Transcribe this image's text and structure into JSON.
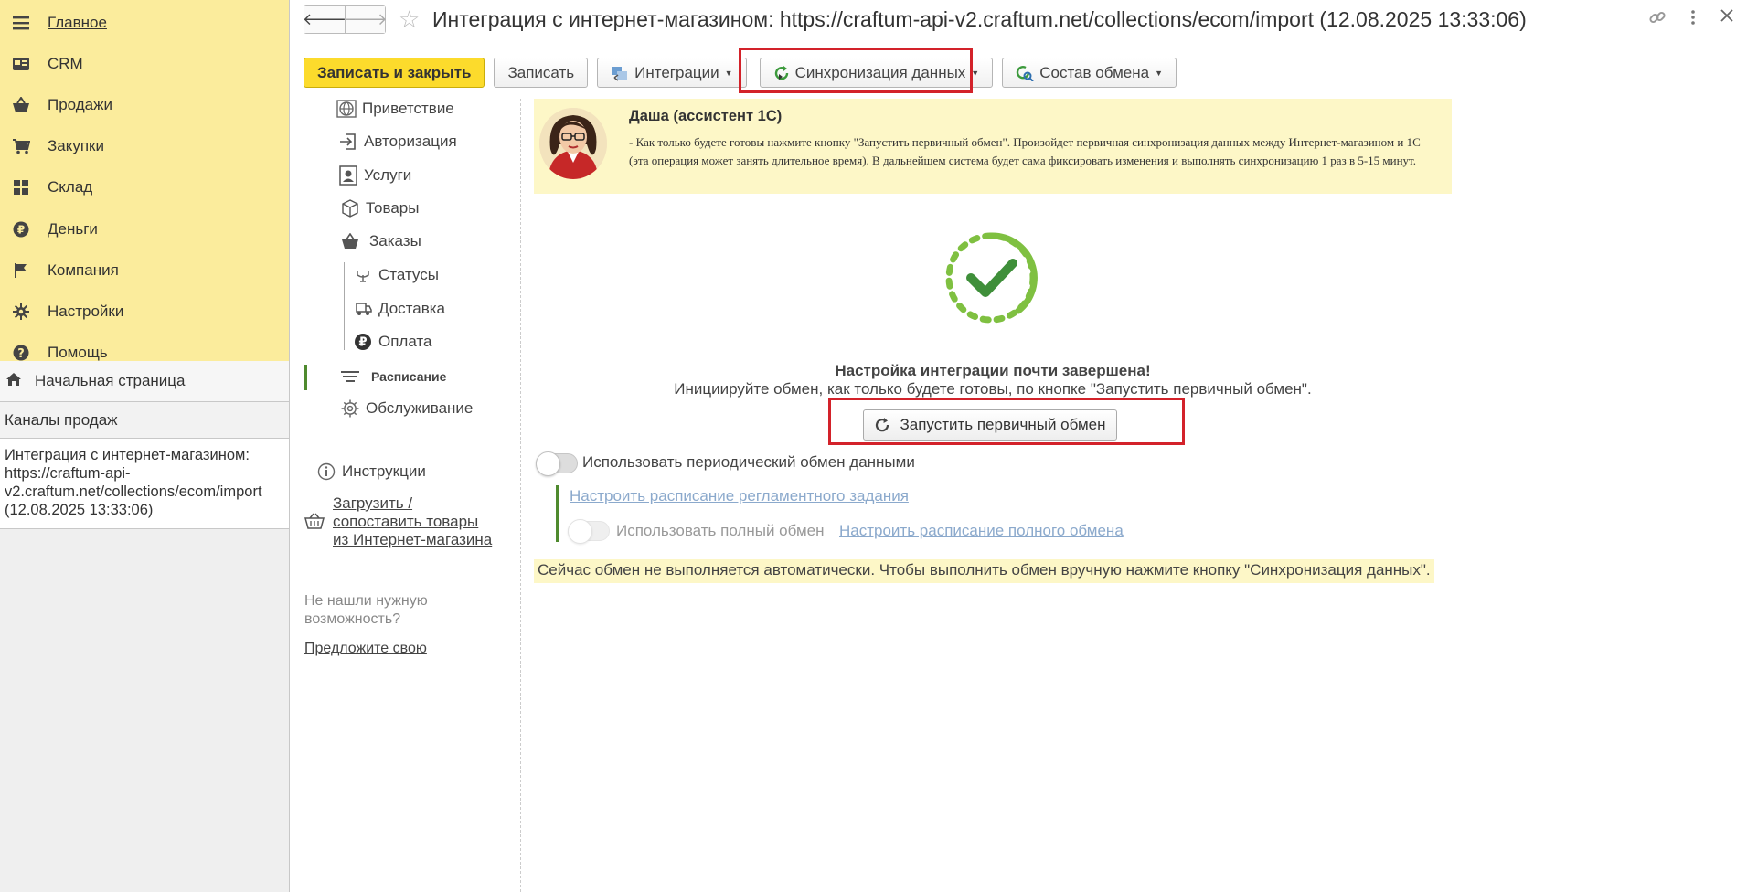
{
  "sidebar": {
    "menu": [
      {
        "label": "Главное",
        "icon": "hamburger-icon"
      },
      {
        "label": "CRM",
        "icon": "crm-icon"
      },
      {
        "label": "Продажи",
        "icon": "basket-icon"
      },
      {
        "label": "Закупки",
        "icon": "cart-icon"
      },
      {
        "label": "Склад",
        "icon": "warehouse-icon"
      },
      {
        "label": "Деньги",
        "icon": "ruble-icon"
      },
      {
        "label": "Компания",
        "icon": "flag-icon"
      },
      {
        "label": "Настройки",
        "icon": "gear-icon"
      },
      {
        "label": "Помощь",
        "icon": "help-icon"
      }
    ],
    "home": "Начальная страница",
    "section": "Каналы продаж",
    "open_window": "Интеграция с интернет-магазином: https://craftum-api-v2.craftum.net/collections/ecom/import (12.08.2025 13:33:06)"
  },
  "header": {
    "title": "Интеграция с интернет-магазином: https://craftum-api-v2.craftum.net/collections/ecom/import (12.08.2025 13:33:06)"
  },
  "toolbar": {
    "save_close": "Записать и закрыть",
    "save": "Записать",
    "integrations": "Интеграции",
    "sync": "Синхронизация данных",
    "exchange": "Состав обмена"
  },
  "nav": {
    "welcome": "Приветствие",
    "auth": "Авторизация",
    "services": "Услуги",
    "goods": "Товары",
    "orders": "Заказы",
    "statuses": "Статусы",
    "delivery": "Доставка",
    "payment": "Оплата",
    "schedule": "Расписание",
    "maintenance": "Обслуживание",
    "instructions": "Инструкции",
    "upload_line1": "Загрузить /",
    "upload_line2": "сопоставить товары",
    "upload_line3": "из Интернет-магазина",
    "not_found_line1": "Не нашли нужную",
    "not_found_line2": "возможность?",
    "suggest": "Предложите свою"
  },
  "assistant": {
    "name": "Даша (ассистент 1С)",
    "text": "- Как только будете готовы нажмите кнопку \"Запустить первичный обмен\". Произойдет первичная синхронизация данных между Интернет-магазином и 1С (эта операция может занять длительное время). В дальнейшем система будет сама фиксировать изменения и выполнять синхронизацию 1 раз в 5-15 минут."
  },
  "status": {
    "title": "Настройка интеграции почти завершена!",
    "subtitle": "Инициируйте обмен, как только будете готовы, по кнопке \"Запустить первичный обмен\".",
    "run_button": "Запустить первичный обмен"
  },
  "options": {
    "periodic": "Использовать периодический обмен данными",
    "periodic_on": false,
    "schedule_link": "Настроить расписание регламентного задания",
    "full": "Использовать полный обмен",
    "full_on": false,
    "full_schedule_link": "Настроить расписание полного обмена"
  },
  "notice": "Сейчас обмен не выполняется автоматически. Чтобы выполнить обмен вручную нажмите кнопку \"Синхронизация данных\".",
  "colors": {
    "sidebar": "#fbec9c",
    "primary_button": "#fcdb2c",
    "accent_green": "#4f8a2e",
    "highlight_red": "#d3222a",
    "assistant_bg": "#fdf7c7"
  }
}
